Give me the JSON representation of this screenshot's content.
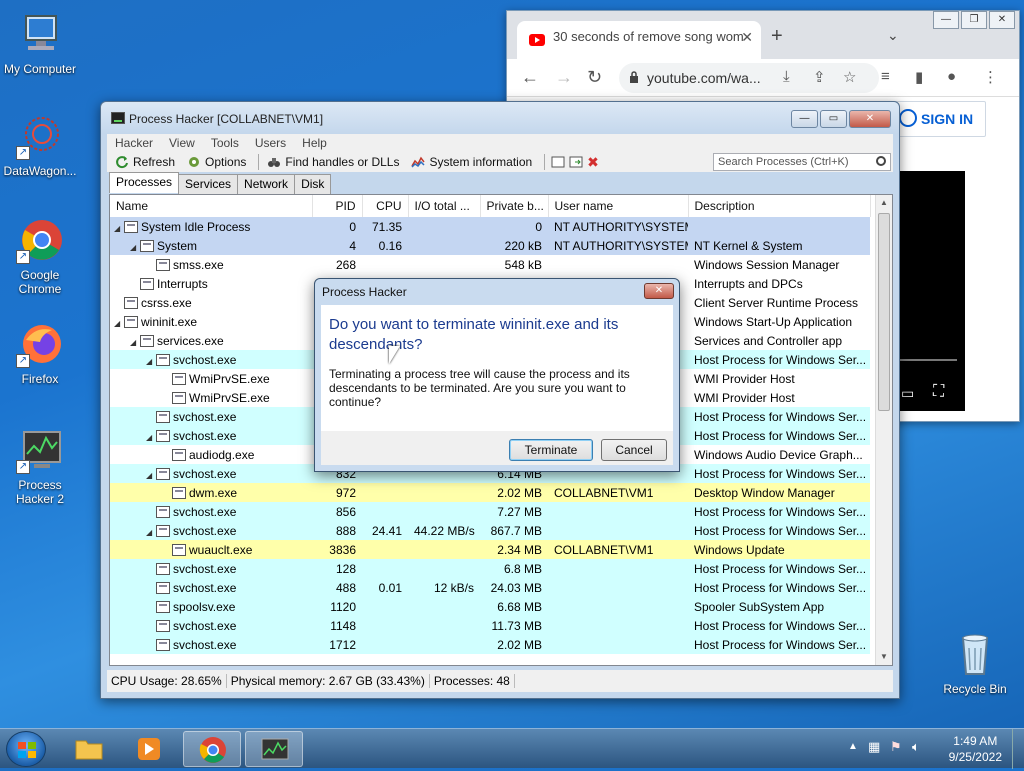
{
  "desktop": {
    "icons": [
      {
        "label": "My Computer"
      },
      {
        "label": "DataWagon..."
      },
      {
        "label": "Google Chrome"
      },
      {
        "label": "Firefox"
      },
      {
        "label": "Process Hacker 2"
      },
      {
        "label": "Recycle Bin"
      }
    ]
  },
  "chrome": {
    "tab_title": "30 seconds of remove song wom",
    "url": "youtube.com/wa...",
    "sign_in": "SIGN IN"
  },
  "ph": {
    "title": "Process Hacker [COLLABNET\\VM1]",
    "menu": [
      "Hacker",
      "View",
      "Tools",
      "Users",
      "Help"
    ],
    "toolbar": {
      "refresh": "Refresh",
      "options": "Options",
      "find_handles": "Find handles or DLLs",
      "system_info": "System information"
    },
    "search_placeholder": "Search Processes (Ctrl+K)",
    "tabs": [
      "Processes",
      "Services",
      "Network",
      "Disk"
    ],
    "columns": [
      "Name",
      "PID",
      "CPU",
      "I/O total ...",
      "Private b...",
      "User name",
      "Description"
    ],
    "rows": [
      {
        "name": "System Idle Process",
        "pid": "0",
        "cpu": "71.35",
        "io": "",
        "priv": "0",
        "user": "NT AUTHORITY\\SYSTEM",
        "desc": "",
        "color": "blue",
        "indent": 0,
        "tri": "◢"
      },
      {
        "name": "System",
        "pid": "4",
        "cpu": "0.16",
        "io": "",
        "priv": "220 kB",
        "user": "NT AUTHORITY\\SYSTEM",
        "desc": "NT Kernel & System",
        "color": "blue",
        "indent": 1,
        "tri": "◢"
      },
      {
        "name": "smss.exe",
        "pid": "268",
        "cpu": "",
        "io": "",
        "priv": "548 kB",
        "user": "",
        "desc": "Windows Session Manager",
        "color": "white",
        "indent": 2,
        "tri": ""
      },
      {
        "name": "Interrupts",
        "pid": "",
        "cpu": "",
        "io": "",
        "priv": "",
        "user": "",
        "desc": "Interrupts and DPCs",
        "color": "white",
        "indent": 1,
        "tri": ""
      },
      {
        "name": "csrss.exe",
        "pid": "",
        "cpu": "",
        "io": "",
        "priv": "",
        "user": "",
        "desc": "Client Server Runtime Process",
        "color": "white",
        "indent": 0,
        "tri": ""
      },
      {
        "name": "wininit.exe",
        "pid": "",
        "cpu": "",
        "io": "",
        "priv": "",
        "user": "",
        "desc": "Windows Start-Up Application",
        "color": "white",
        "indent": 0,
        "tri": "◢"
      },
      {
        "name": "services.exe",
        "pid": "",
        "cpu": "",
        "io": "",
        "priv": "",
        "user": "",
        "desc": "Services and Controller app",
        "color": "white",
        "indent": 1,
        "tri": "◢"
      },
      {
        "name": "svchost.exe",
        "pid": "",
        "cpu": "",
        "io": "",
        "priv": "",
        "user": "",
        "desc": "Host Process for Windows Ser...",
        "color": "teal",
        "indent": 2,
        "tri": "◢"
      },
      {
        "name": "WmiPrvSE.exe",
        "pid": "",
        "cpu": "",
        "io": "",
        "priv": "",
        "user": "",
        "desc": "WMI Provider Host",
        "color": "white",
        "indent": 3,
        "tri": ""
      },
      {
        "name": "WmiPrvSE.exe",
        "pid": "",
        "cpu": "",
        "io": "",
        "priv": "",
        "user": "",
        "desc": "WMI Provider Host",
        "color": "white",
        "indent": 3,
        "tri": ""
      },
      {
        "name": "svchost.exe",
        "pid": "",
        "cpu": "",
        "io": "",
        "priv": "",
        "user": "",
        "desc": "Host Process for Windows Ser...",
        "color": "teal",
        "indent": 2,
        "tri": ""
      },
      {
        "name": "svchost.exe",
        "pid": "",
        "cpu": "",
        "io": "",
        "priv": "",
        "user": "",
        "desc": "Host Process for Windows Ser...",
        "color": "teal",
        "indent": 2,
        "tri": "◢"
      },
      {
        "name": "audiodg.exe",
        "pid": "",
        "cpu": "",
        "io": "",
        "priv": "",
        "user": "",
        "desc": "Windows Audio Device Graph...",
        "color": "white",
        "indent": 3,
        "tri": ""
      },
      {
        "name": "svchost.exe",
        "pid": "832",
        "cpu": "",
        "io": "",
        "priv": "6.14 MB",
        "user": "",
        "desc": "Host Process for Windows Ser...",
        "color": "teal",
        "indent": 2,
        "tri": "◢"
      },
      {
        "name": "dwm.exe",
        "pid": "972",
        "cpu": "",
        "io": "",
        "priv": "2.02 MB",
        "user": "COLLABNET\\VM1",
        "desc": "Desktop Window Manager",
        "color": "yellow",
        "indent": 3,
        "tri": ""
      },
      {
        "name": "svchost.exe",
        "pid": "856",
        "cpu": "",
        "io": "",
        "priv": "7.27 MB",
        "user": "",
        "desc": "Host Process for Windows Ser...",
        "color": "teal",
        "indent": 2,
        "tri": ""
      },
      {
        "name": "svchost.exe",
        "pid": "888",
        "cpu": "24.41",
        "io": "44.22 MB/s",
        "priv": "867.7 MB",
        "user": "",
        "desc": "Host Process for Windows Ser...",
        "color": "teal",
        "indent": 2,
        "tri": "◢"
      },
      {
        "name": "wuauclt.exe",
        "pid": "3836",
        "cpu": "",
        "io": "",
        "priv": "2.34 MB",
        "user": "COLLABNET\\VM1",
        "desc": "Windows Update",
        "color": "yellow",
        "indent": 3,
        "tri": ""
      },
      {
        "name": "svchost.exe",
        "pid": "128",
        "cpu": "",
        "io": "",
        "priv": "6.8 MB",
        "user": "",
        "desc": "Host Process for Windows Ser...",
        "color": "teal",
        "indent": 2,
        "tri": ""
      },
      {
        "name": "svchost.exe",
        "pid": "488",
        "cpu": "0.01",
        "io": "12 kB/s",
        "priv": "24.03 MB",
        "user": "",
        "desc": "Host Process for Windows Ser...",
        "color": "teal",
        "indent": 2,
        "tri": ""
      },
      {
        "name": "spoolsv.exe",
        "pid": "1120",
        "cpu": "",
        "io": "",
        "priv": "6.68 MB",
        "user": "",
        "desc": "Spooler SubSystem App",
        "color": "teal",
        "indent": 2,
        "tri": ""
      },
      {
        "name": "svchost.exe",
        "pid": "1148",
        "cpu": "",
        "io": "",
        "priv": "11.73 MB",
        "user": "",
        "desc": "Host Process for Windows Ser...",
        "color": "teal",
        "indent": 2,
        "tri": ""
      },
      {
        "name": "svchost.exe",
        "pid": "1712",
        "cpu": "",
        "io": "",
        "priv": "2.02 MB",
        "user": "",
        "desc": "Host Process for Windows Ser...",
        "color": "teal",
        "indent": 2,
        "tri": ""
      }
    ],
    "status": {
      "cpu": "CPU Usage: 28.65%",
      "memory": "Physical memory: 2.67 GB (33.43%)",
      "processes": "Processes: 48"
    }
  },
  "dialog": {
    "title": "Process Hacker",
    "heading": "Do you want to terminate wininit.exe and its descendants?",
    "message": "Terminating a process tree will cause the process and its descendants to be terminated. Are you sure you want to continue?",
    "terminate": "Terminate",
    "cancel": "Cancel"
  },
  "taskbar": {
    "time": "1:49 AM",
    "date": "9/25/2022"
  }
}
